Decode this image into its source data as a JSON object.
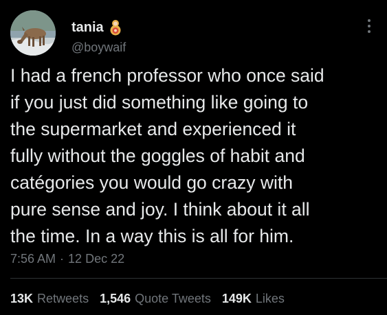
{
  "tweet": {
    "display_name": "tania",
    "handle": "@boywaif",
    "lines": [
      "I had a french professor who once said",
      "if you just did something like going to",
      "the supermarket and experienced it",
      "fully without the goggles of habit and",
      "catégories you would go crazy with",
      "pure sense and joy. I think about it all",
      "the time. In a way this is all for him."
    ],
    "time": "7:56 AM",
    "separator": "·",
    "date": "12 Dec 22",
    "emoji_icon": "nesting-doll-icon",
    "more_icon": "more-options-icon"
  },
  "stats": [
    {
      "num": "13K",
      "label": "Retweets"
    },
    {
      "num": "1,546",
      "label": "Quote Tweets"
    },
    {
      "num": "149K",
      "label": "Likes"
    }
  ],
  "colors": {
    "background": "#000000",
    "text": "#e7e9ea",
    "muted": "#71767b",
    "divider": "#2f3336"
  }
}
